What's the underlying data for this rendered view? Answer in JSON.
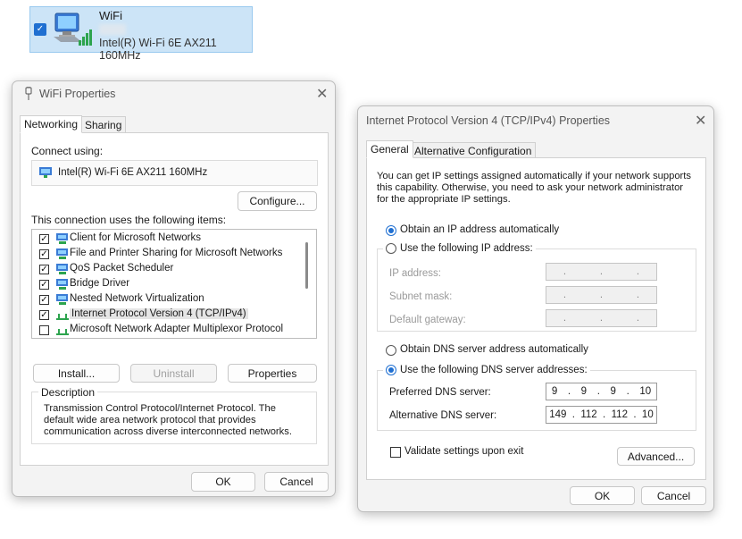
{
  "adapter_tile": {
    "name": "WiFi",
    "device": "Intel(R) Wi-Fi 6E AX211 160MHz"
  },
  "wifi_properties": {
    "title": "WiFi Properties",
    "tabs": [
      "Networking",
      "Sharing"
    ],
    "connect_using_label": "Connect using:",
    "adapter_name": "Intel(R) Wi-Fi 6E AX211 160MHz",
    "configure_label": "Configure...",
    "items_label": "This connection uses the following items:",
    "items": [
      {
        "label": "Client for Microsoft Networks",
        "checked": true
      },
      {
        "label": "File and Printer Sharing for Microsoft Networks",
        "checked": true
      },
      {
        "label": "QoS Packet Scheduler",
        "checked": true
      },
      {
        "label": "Bridge Driver",
        "checked": true
      },
      {
        "label": "Nested Network Virtualization",
        "checked": true
      },
      {
        "label": "Internet Protocol Version 4 (TCP/IPv4)",
        "checked": true
      },
      {
        "label": "Microsoft Network Adapter Multiplexor Protocol",
        "checked": false
      }
    ],
    "install_label": "Install...",
    "uninstall_label": "Uninstall",
    "properties_label": "Properties",
    "description_heading": "Description",
    "description_text": "Transmission Control Protocol/Internet Protocol. The default wide area network protocol that provides communication across diverse interconnected networks.",
    "ok_label": "OK",
    "cancel_label": "Cancel"
  },
  "ipv4_properties": {
    "title": "Internet Protocol Version 4 (TCP/IPv4) Properties",
    "tabs": [
      "General",
      "Alternative Configuration"
    ],
    "intro_text": "You can get IP settings assigned automatically if your network supports this capability. Otherwise, you need to ask your network administrator for the appropriate IP settings.",
    "obtain_ip_auto": "Obtain an IP address automatically",
    "use_following_ip": "Use the following IP address:",
    "ip_address_label": "IP address:",
    "subnet_mask_label": "Subnet mask:",
    "default_gateway_label": "Default gateway:",
    "obtain_dns_auto": "Obtain DNS server address automatically",
    "use_following_dns": "Use the following DNS server addresses:",
    "preferred_dns_label": "Preferred DNS server:",
    "preferred_dns": [
      "9",
      "9",
      "9",
      "10"
    ],
    "alternative_dns_label": "Alternative DNS server:",
    "alternative_dns": [
      "149",
      "112",
      "112",
      "10"
    ],
    "validate_label": "Validate settings upon exit",
    "advanced_label": "Advanced...",
    "ok_label": "OK",
    "cancel_label": "Cancel"
  }
}
